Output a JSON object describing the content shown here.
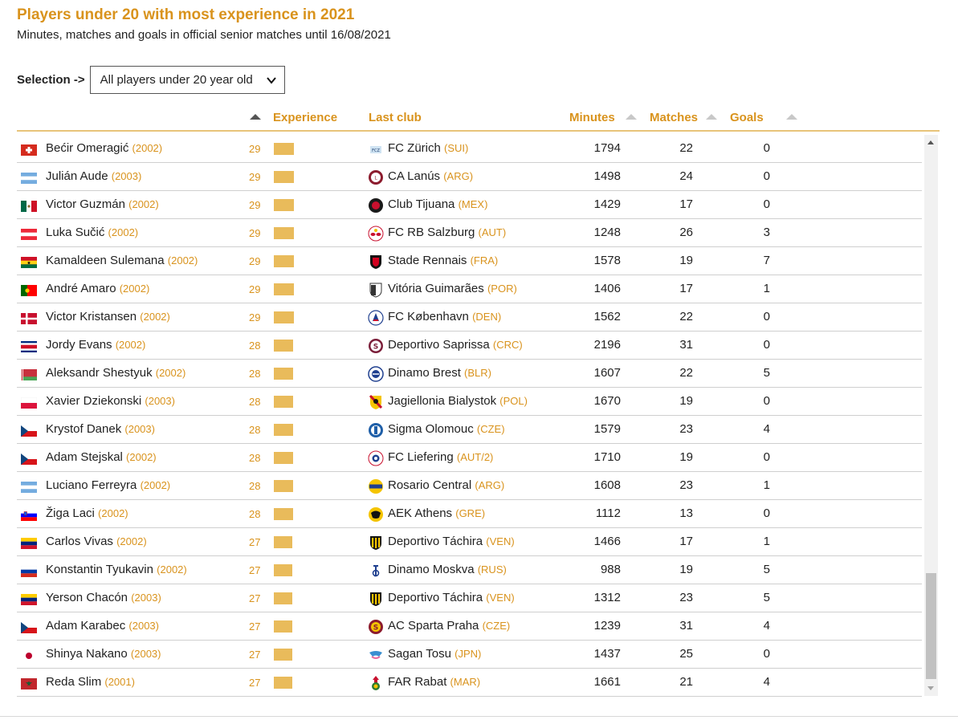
{
  "title": "Players under 20 with most experience in 2021",
  "subtitle": "Minutes, matches and goals in official senior matches until 16/08/2021",
  "selection": {
    "label": "Selection ->",
    "value": "All players under 20 year old"
  },
  "headers": {
    "experience": "Experience",
    "club": "Last club",
    "minutes": "Minutes",
    "matches": "Matches",
    "goals": "Goals"
  },
  "colors": {
    "accent": "#d9931d",
    "bar": "#e9bb5b"
  },
  "rows": [
    {
      "name": "Bećir Omeragić",
      "year": "(2002)",
      "exp": "29",
      "club": "FC Zürich",
      "country": "(SUI)",
      "minutes": "1794",
      "matches": "22",
      "goals": "0",
      "flag": "switzerland-flag",
      "logo": "fc-zurich-logo"
    },
    {
      "name": "Julián Aude",
      "year": "(2003)",
      "exp": "29",
      "club": "CA Lanús",
      "country": "(ARG)",
      "minutes": "1498",
      "matches": "24",
      "goals": "0",
      "flag": "argentina-flag",
      "logo": "ca-lanus-logo"
    },
    {
      "name": "Victor Guzmán",
      "year": "(2002)",
      "exp": "29",
      "club": "Club Tijuana",
      "country": "(MEX)",
      "minutes": "1429",
      "matches": "17",
      "goals": "0",
      "flag": "mexico-flag",
      "logo": "club-tijuana-logo"
    },
    {
      "name": "Luka Sučić",
      "year": "(2002)",
      "exp": "29",
      "club": "FC RB Salzburg",
      "country": "(AUT)",
      "minutes": "1248",
      "matches": "26",
      "goals": "3",
      "flag": "austria-flag",
      "logo": "rb-salzburg-logo"
    },
    {
      "name": "Kamaldeen Sulemana",
      "year": "(2002)",
      "exp": "29",
      "club": "Stade Rennais",
      "country": "(FRA)",
      "minutes": "1578",
      "matches": "19",
      "goals": "7",
      "flag": "ghana-flag",
      "logo": "stade-rennais-logo"
    },
    {
      "name": "André Amaro",
      "year": "(2002)",
      "exp": "29",
      "club": "Vitória Guimarães",
      "country": "(POR)",
      "minutes": "1406",
      "matches": "17",
      "goals": "1",
      "flag": "portugal-flag",
      "logo": "vitoria-guimaraes-logo"
    },
    {
      "name": "Victor Kristansen",
      "year": "(2002)",
      "exp": "29",
      "club": "FC København",
      "country": "(DEN)",
      "minutes": "1562",
      "matches": "22",
      "goals": "0",
      "flag": "denmark-flag",
      "logo": "fc-kobenhavn-logo"
    },
    {
      "name": "Jordy Evans",
      "year": "(2002)",
      "exp": "28",
      "club": "Deportivo Saprissa",
      "country": "(CRC)",
      "minutes": "2196",
      "matches": "31",
      "goals": "0",
      "flag": "costa-rica-flag",
      "logo": "saprissa-logo"
    },
    {
      "name": "Aleksandr Shestyuk",
      "year": "(2002)",
      "exp": "28",
      "club": "Dinamo Brest",
      "country": "(BLR)",
      "minutes": "1607",
      "matches": "22",
      "goals": "5",
      "flag": "belarus-flag",
      "logo": "dinamo-brest-logo"
    },
    {
      "name": "Xavier Dziekonski",
      "year": "(2003)",
      "exp": "28",
      "club": "Jagiellonia Bialystok",
      "country": "(POL)",
      "minutes": "1670",
      "matches": "19",
      "goals": "0",
      "flag": "poland-flag",
      "logo": "jagiellonia-logo"
    },
    {
      "name": "Krystof Danek",
      "year": "(2003)",
      "exp": "28",
      "club": "Sigma Olomouc",
      "country": "(CZE)",
      "minutes": "1579",
      "matches": "23",
      "goals": "4",
      "flag": "czechia-flag",
      "logo": "sigma-olomouc-logo"
    },
    {
      "name": "Adam Stejskal",
      "year": "(2002)",
      "exp": "28",
      "club": "FC Liefering",
      "country": "(AUT/2)",
      "minutes": "1710",
      "matches": "19",
      "goals": "0",
      "flag": "czechia-flag",
      "logo": "fc-liefering-logo"
    },
    {
      "name": "Luciano Ferreyra",
      "year": "(2002)",
      "exp": "28",
      "club": "Rosario Central",
      "country": "(ARG)",
      "minutes": "1608",
      "matches": "23",
      "goals": "1",
      "flag": "argentina-flag",
      "logo": "rosario-central-logo"
    },
    {
      "name": "Žiga Laci",
      "year": "(2002)",
      "exp": "28",
      "club": "AEK Athens",
      "country": "(GRE)",
      "minutes": "1112",
      "matches": "13",
      "goals": "0",
      "flag": "slovenia-flag",
      "logo": "aek-athens-logo"
    },
    {
      "name": "Carlos Vivas",
      "year": "(2002)",
      "exp": "27",
      "club": "Deportivo Táchira",
      "country": "(VEN)",
      "minutes": "1466",
      "matches": "17",
      "goals": "1",
      "flag": "venezuela-flag",
      "logo": "deportivo-tachira-logo"
    },
    {
      "name": "Konstantin Tyukavin",
      "year": "(2002)",
      "exp": "27",
      "club": "Dinamo Moskva",
      "country": "(RUS)",
      "minutes": "988",
      "matches": "19",
      "goals": "5",
      "flag": "russia-flag",
      "logo": "dinamo-moskva-logo"
    },
    {
      "name": "Yerson Chacón",
      "year": "(2003)",
      "exp": "27",
      "club": "Deportivo Táchira",
      "country": "(VEN)",
      "minutes": "1312",
      "matches": "23",
      "goals": "5",
      "flag": "venezuela-flag",
      "logo": "deportivo-tachira-logo"
    },
    {
      "name": "Adam Karabec",
      "year": "(2003)",
      "exp": "27",
      "club": "AC Sparta Praha",
      "country": "(CZE)",
      "minutes": "1239",
      "matches": "31",
      "goals": "4",
      "flag": "czechia-flag",
      "logo": "sparta-praha-logo"
    },
    {
      "name": "Shinya Nakano",
      "year": "(2003)",
      "exp": "27",
      "club": "Sagan Tosu",
      "country": "(JPN)",
      "minutes": "1437",
      "matches": "25",
      "goals": "0",
      "flag": "japan-flag",
      "logo": "sagan-tosu-logo"
    },
    {
      "name": "Reda Slim",
      "year": "(2001)",
      "exp": "27",
      "club": "FAR Rabat",
      "country": "(MAR)",
      "minutes": "1661",
      "matches": "21",
      "goals": "4",
      "flag": "morocco-flag",
      "logo": "far-rabat-logo"
    }
  ]
}
